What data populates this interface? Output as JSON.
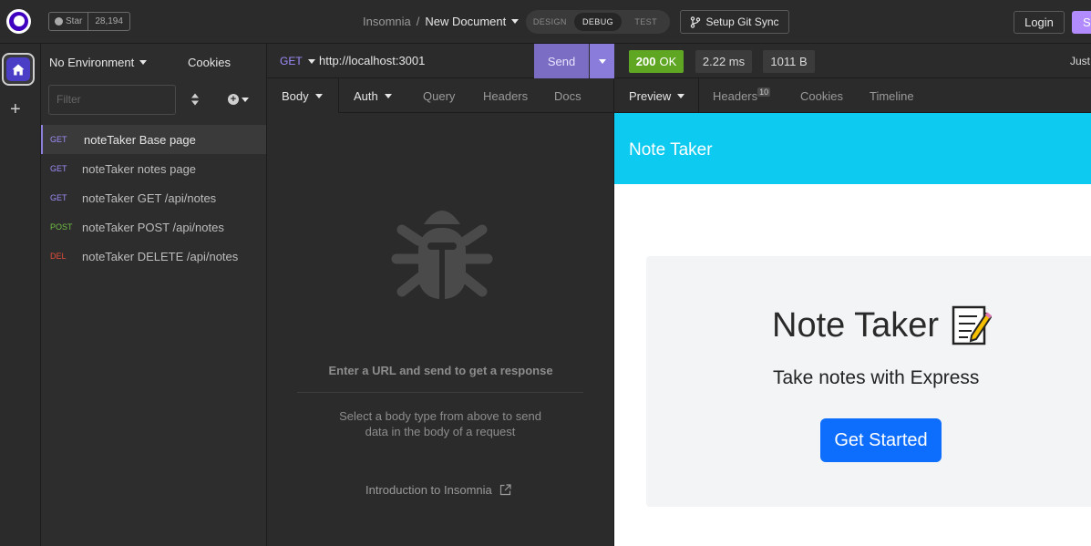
{
  "topbar": {
    "github": {
      "star_label": "Star",
      "star_count": "28,194"
    },
    "breadcrumb": {
      "project": "Insomnia",
      "separator": "/",
      "document": "New Document"
    },
    "modes": [
      "DESIGN",
      "DEBUG",
      "TEST"
    ],
    "active_mode": "DEBUG",
    "git_sync_label": "Setup Git Sync",
    "login_label": "Login",
    "signup_label": "S"
  },
  "sidebar": {
    "environment": "No Environment",
    "cookies": "Cookies",
    "filter_placeholder": "Filter",
    "requests": [
      {
        "method": "GET",
        "name": "noteTaker Base page"
      },
      {
        "method": "GET",
        "name": "noteTaker notes page"
      },
      {
        "method": "GET",
        "name": "noteTaker GET /api/notes"
      },
      {
        "method": "POST",
        "name": "noteTaker POST /api/notes"
      },
      {
        "method": "DEL",
        "name": "noteTaker DELETE /api/notes"
      }
    ]
  },
  "request": {
    "method": "GET",
    "url": "http://localhost:3001",
    "send_label": "Send",
    "tabs": {
      "body": "Body",
      "auth": "Auth",
      "query": "Query",
      "headers": "Headers",
      "docs": "Docs"
    },
    "empty_title": "Enter a URL and send to get a response",
    "empty_desc": "Select a body type from above to send data in the body of a request",
    "intro_link": "Introduction to Insomnia"
  },
  "response": {
    "status_code": "200",
    "status_text": "OK",
    "time": "2.22 ms",
    "size": "1011 B",
    "timestamp": "Just",
    "tabs": {
      "preview": "Preview",
      "headers": "Headers",
      "headers_count": "10",
      "cookies": "Cookies",
      "timeline": "Timeline"
    },
    "page": {
      "nav_brand": "Note Taker",
      "title": "Note Taker",
      "subtitle": "Take notes with Express",
      "button": "Get Started"
    }
  },
  "colors": {
    "accent": "#7c6dc4",
    "status_ok": "#5fa722",
    "method_get": "#9d8dfa",
    "method_post": "#6fbf44",
    "method_del": "#e34e3c",
    "preview_nav": "#0dcaf0",
    "preview_button": "#0d6efd"
  }
}
